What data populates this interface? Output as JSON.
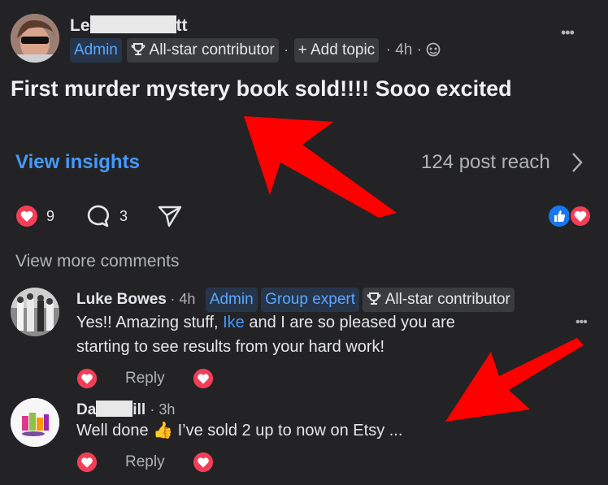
{
  "post": {
    "author_prefix": "Le",
    "author_suffix": "tt",
    "badges": {
      "admin": "Admin",
      "allstar": "All-star contributor",
      "add_topic": "+ Add topic"
    },
    "separator": "·",
    "time": "4h ·",
    "menu": "•••",
    "text": "First murder mystery book sold!!!! Sooo excited",
    "view_insights": "View insights",
    "reach": "124 post reach",
    "reactions_count": "9",
    "comments_count": "3"
  },
  "comments_section": {
    "view_more": "View more comments",
    "comments": [
      {
        "author": "Luke Bowes",
        "time": "· 4h",
        "badges": [
          "Admin",
          "Group expert",
          "All-star contributor"
        ],
        "text_before": "Yes!! Amazing stuff, ",
        "mention": "Ike",
        "text_after": " and I are so pleased you are",
        "text_line2": "starting to see results from your hard work!",
        "reply_label": "Reply",
        "menu": "•••"
      },
      {
        "author_prefix": "Da",
        "author_suffix": "ill",
        "time": "· 3h",
        "text_before": "Well done ",
        "emoji": "👍",
        "text_after": " I’ve sold 2 up to now on Etsy ...",
        "reply_label": "Reply"
      }
    ]
  },
  "colors": {
    "background": "#232325",
    "accent_blue": "#4599ff",
    "annotation_arrow": "#ff0000",
    "reaction_red": "#f33e58"
  }
}
